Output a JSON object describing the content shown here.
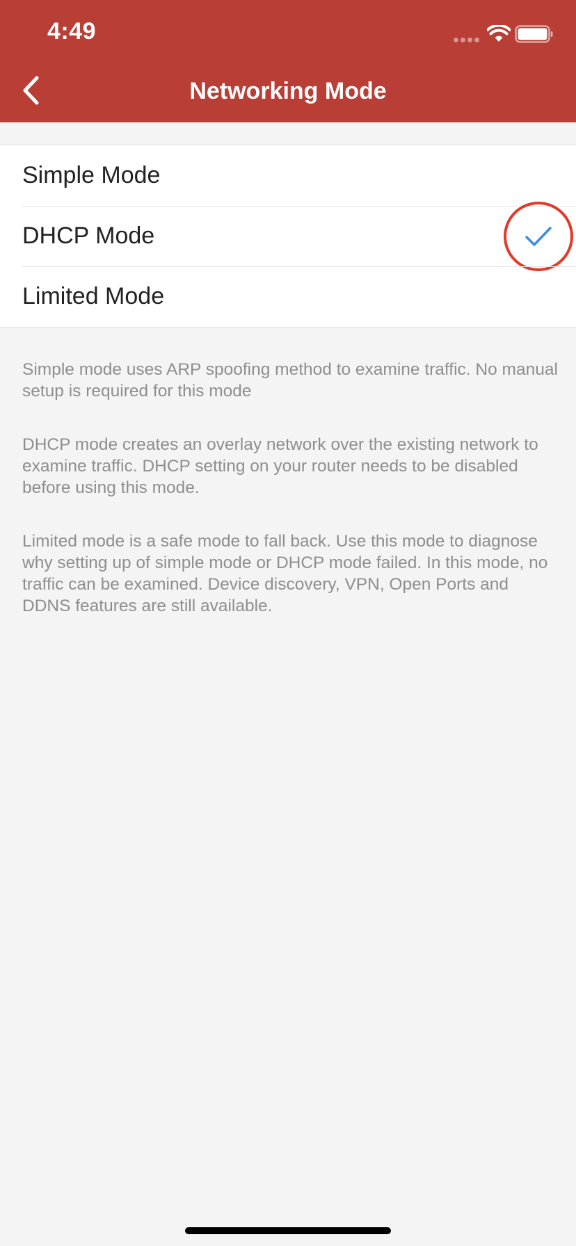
{
  "status_bar": {
    "time": "4:49"
  },
  "nav": {
    "title": "Networking Mode",
    "back_icon": "chevron-left-icon"
  },
  "modes": [
    {
      "label": "Simple Mode",
      "selected": false
    },
    {
      "label": "DHCP Mode",
      "selected": true
    },
    {
      "label": "Limited Mode",
      "selected": false
    }
  ],
  "descriptions": [
    "Simple mode uses ARP spoofing method to examine traffic. No manual setup is required for this mode",
    "DHCP mode creates an overlay network over the existing network to examine traffic. DHCP setting on your router needs to be disabled before using this mode.",
    "Limited mode is a safe mode to fall back. Use this mode to diagnose why setting up of simple mode or DHCP mode failed. In this mode, no traffic can be examined. Device discovery, VPN, Open Ports and DDNS features are still available."
  ],
  "colors": {
    "header": "#b93e35",
    "check": "#3b8ede",
    "highlight_circle": "#e1392a",
    "background": "#f4f4f4"
  }
}
